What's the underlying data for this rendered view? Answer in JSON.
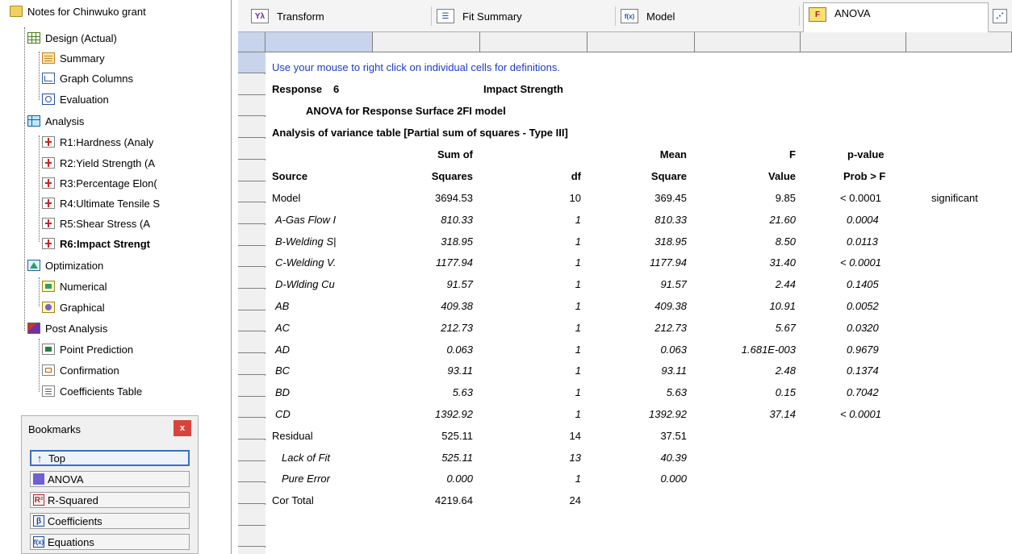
{
  "tree": {
    "root": "Notes for Chinwuko grant",
    "design": "Design (Actual)",
    "design_items": [
      "Summary",
      "Graph Columns",
      "Evaluation"
    ],
    "analysis": "Analysis",
    "responses": [
      "R1:Hardness (Analy",
      "R2:Yield Strength (A",
      "R3:Percentage Elon(",
      "R4:Ultimate Tensile S",
      "R5:Shear Stress (A",
      "R6:Impact Strengt"
    ],
    "optimization": "Optimization",
    "optimization_items": [
      "Numerical",
      "Graphical"
    ],
    "post_analysis": "Post Analysis",
    "post_items": [
      "Point Prediction",
      "Confirmation",
      "Coefficients Table"
    ]
  },
  "bookmarks": {
    "title": "Bookmarks",
    "close": "x",
    "items": [
      "Top",
      "ANOVA",
      "R-Squared",
      "Coefficients",
      "Equations"
    ]
  },
  "tabs": [
    {
      "label": "Transform",
      "icon": "transform-icon",
      "glyph": "Yλ"
    },
    {
      "label": "Fit Summary",
      "icon": "fit-summary-icon",
      "glyph": "☰"
    },
    {
      "label": "Model",
      "icon": "model-icon",
      "glyph": "f(x)"
    },
    {
      "label": "ANOVA",
      "icon": "anova-icon",
      "glyph": "F"
    }
  ],
  "report": {
    "hint": "Use your mouse to right click on individual cells for definitions.",
    "response_label": "Response",
    "response_number": "6",
    "response_name": "Impact Strength",
    "anova_title": "ANOVA for Response Surface 2FI model",
    "variance_title": "Analysis of variance table [Partial sum of squares - Type III]",
    "headers": {
      "row1": [
        "",
        "Sum of",
        "",
        "Mean",
        "F",
        "p-value"
      ],
      "row2": [
        "Source",
        "Squares",
        "df",
        "Square",
        "Value",
        "Prob > F"
      ]
    },
    "rows": [
      {
        "source": "Model",
        "ss": "3694.53",
        "df": "10",
        "ms": "369.45",
        "f": "9.85",
        "p": "< 0.0001",
        "note": "significant",
        "italic": false
      },
      {
        "source": "A-Gas Flow I",
        "ss": "810.33",
        "df": "1",
        "ms": "810.33",
        "f": "21.60",
        "p": "0.0004",
        "note": "",
        "italic": true
      },
      {
        "source": "B-Welding S|",
        "ss": "318.95",
        "df": "1",
        "ms": "318.95",
        "f": "8.50",
        "p": "0.0113",
        "note": "",
        "italic": true
      },
      {
        "source": "C-Welding V.",
        "ss": "1177.94",
        "df": "1",
        "ms": "1177.94",
        "f": "31.40",
        "p": "< 0.0001",
        "note": "",
        "italic": true
      },
      {
        "source": "D-Wlding Cu",
        "ss": "91.57",
        "df": "1",
        "ms": "91.57",
        "f": "2.44",
        "p": "0.1405",
        "note": "",
        "italic": true
      },
      {
        "source": "AB",
        "ss": "409.38",
        "df": "1",
        "ms": "409.38",
        "f": "10.91",
        "p": "0.0052",
        "note": "",
        "italic": true
      },
      {
        "source": "AC",
        "ss": "212.73",
        "df": "1",
        "ms": "212.73",
        "f": "5.67",
        "p": "0.0320",
        "note": "",
        "italic": true
      },
      {
        "source": "AD",
        "ss": "0.063",
        "df": "1",
        "ms": "0.063",
        "f": "1.681E-003",
        "p": "0.9679",
        "note": "",
        "italic": true
      },
      {
        "source": "BC",
        "ss": "93.11",
        "df": "1",
        "ms": "93.11",
        "f": "2.48",
        "p": "0.1374",
        "note": "",
        "italic": true
      },
      {
        "source": "BD",
        "ss": "5.63",
        "df": "1",
        "ms": "5.63",
        "f": "0.15",
        "p": "0.7042",
        "note": "",
        "italic": true
      },
      {
        "source": "CD",
        "ss": "1392.92",
        "df": "1",
        "ms": "1392.92",
        "f": "37.14",
        "p": "< 0.0001",
        "note": "",
        "italic": true
      },
      {
        "source": "Residual",
        "ss": "525.11",
        "df": "14",
        "ms": "37.51",
        "f": "",
        "p": "",
        "note": "",
        "italic": false
      },
      {
        "source": "Lack of Fit",
        "ss": "525.11",
        "df": "13",
        "ms": "40.39",
        "f": "",
        "p": "",
        "note": "",
        "italic": true,
        "indent": true
      },
      {
        "source": "Pure Error",
        "ss": "0.000",
        "df": "1",
        "ms": "0.000",
        "f": "",
        "p": "",
        "note": "",
        "italic": true,
        "indent": true
      },
      {
        "source": "Cor Total",
        "ss": "4219.64",
        "df": "24",
        "ms": "",
        "f": "",
        "p": "",
        "note": "",
        "italic": false
      }
    ]
  },
  "colors": {
    "hint_text": "#1a3cc8",
    "selected_header": "#c8d4ec",
    "close_button": "#d9433b"
  }
}
